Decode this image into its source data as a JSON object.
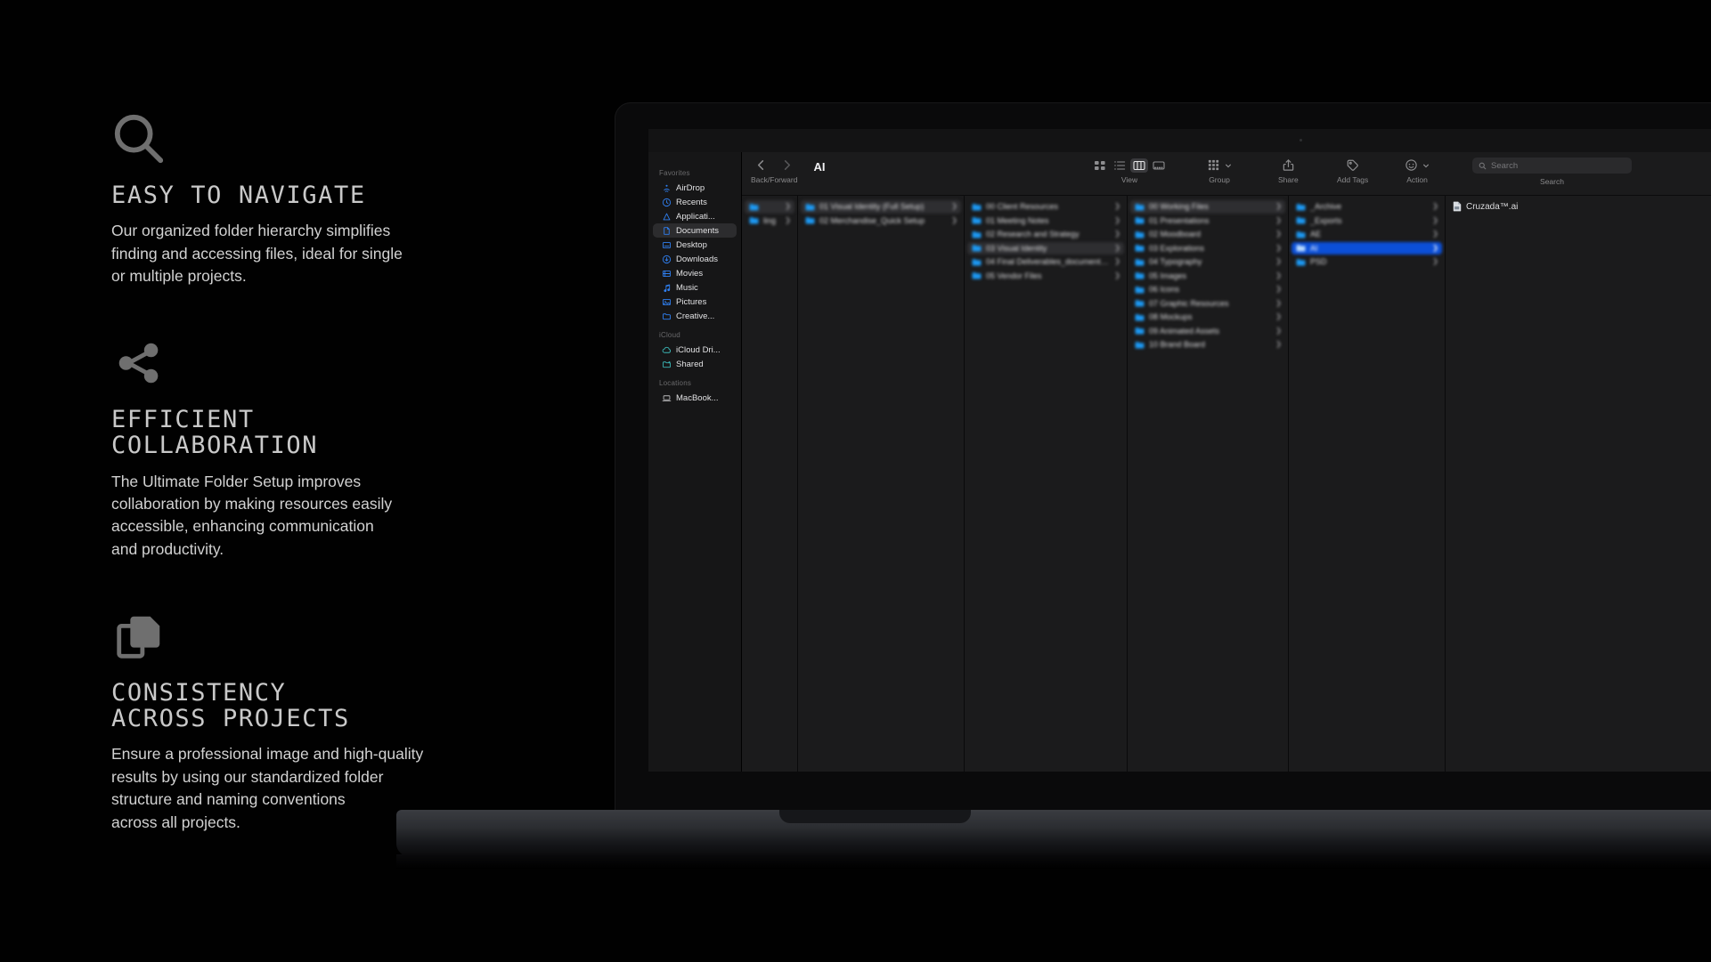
{
  "features": [
    {
      "icon": "magnifier-icon",
      "title": "EASY TO NAVIGATE",
      "body": "Our organized folder hierarchy simplifies\nfinding and accessing files, ideal for single\nor multiple projects."
    },
    {
      "icon": "share-nodes-icon",
      "title": "EFFICIENT\nCOLLABORATION",
      "body": "The Ultimate Folder Setup improves\ncollaboration by making resources easily\naccessible, enhancing communication\nand productivity."
    },
    {
      "icon": "copy-documents-icon",
      "title": "CONSISTENCY\nACROSS PROJECTS",
      "body": "Ensure a professional image and high-quality\nresults by using our standardized folder\nstructure and naming conventions\nacross all projects."
    }
  ],
  "finder": {
    "window_title": "AI",
    "toolbar": {
      "nav_caption": "Back/Forward",
      "back_icon": "chevron-left-icon",
      "forward_icon": "chevron-right-icon",
      "view_caption": "View",
      "view_icon_grid": "icon-view-icon",
      "view_icon_list": "list-view-icon",
      "view_icon_column": "column-view-icon",
      "view_icon_gallery": "gallery-view-icon",
      "group_caption": "Group",
      "group_icon": "group-icon",
      "share_caption": "Share",
      "share_icon": "share-icon",
      "tags_caption": "Add Tags",
      "tags_icon": "tag-icon",
      "action_caption": "Action",
      "action_icon": "action-ellipsis-icon",
      "search_caption": "Search",
      "search_placeholder": "Search",
      "search_icon": "search-icon"
    },
    "sidebar": {
      "sections": [
        {
          "label": "Favorites",
          "items": [
            {
              "label": "AirDrop",
              "icon": "airdrop-icon",
              "selected": false
            },
            {
              "label": "Recents",
              "icon": "clock-icon",
              "selected": false
            },
            {
              "label": "Applicati...",
              "icon": "applications-icon",
              "selected": false
            },
            {
              "label": "Documents",
              "icon": "document-icon",
              "selected": true
            },
            {
              "label": "Desktop",
              "icon": "desktop-icon",
              "selected": false
            },
            {
              "label": "Downloads",
              "icon": "downloads-icon",
              "selected": false
            },
            {
              "label": "Movies",
              "icon": "movies-icon",
              "selected": false
            },
            {
              "label": "Music",
              "icon": "music-note-icon",
              "selected": false
            },
            {
              "label": "Pictures",
              "icon": "pictures-icon",
              "selected": false
            },
            {
              "label": "Creative...",
              "icon": "folder-icon",
              "selected": false
            }
          ]
        },
        {
          "label": "iCloud",
          "items": [
            {
              "label": "iCloud Dri...",
              "icon": "cloud-icon",
              "selected": false
            },
            {
              "label": "Shared",
              "icon": "shared-folder-icon",
              "selected": false
            }
          ]
        },
        {
          "label": "Locations",
          "items": [
            {
              "label": "MacBook...",
              "icon": "laptop-icon",
              "selected": false
            }
          ]
        }
      ]
    },
    "columns": [
      {
        "name": "column-clipped",
        "blurred": true,
        "items": [
          {
            "label": "",
            "selected": false,
            "highlighted": true,
            "has_chevron": true
          },
          {
            "label": "ling",
            "selected": false,
            "highlighted": false,
            "has_chevron": true
          }
        ]
      },
      {
        "name": "column-projects",
        "blurred": true,
        "items": [
          {
            "label": "01 Visual Identity (Full Setup)",
            "selected": false,
            "highlighted": true,
            "has_chevron": true
          },
          {
            "label": "02 Merchandise_Quick Setup",
            "selected": false,
            "highlighted": false,
            "has_chevron": true
          }
        ]
      },
      {
        "name": "column-project-root",
        "blurred": true,
        "items": [
          {
            "label": "00 Client Resources",
            "selected": false,
            "highlighted": false,
            "has_chevron": true
          },
          {
            "label": "01 Meeting Notes",
            "selected": false,
            "highlighted": false,
            "has_chevron": true
          },
          {
            "label": "02 Research and Strategy",
            "selected": false,
            "highlighted": false,
            "has_chevron": true
          },
          {
            "label": "03 Visual Identity",
            "selected": false,
            "highlighted": true,
            "has_chevron": true
          },
          {
            "label": "04 Final Deliverables_documentation",
            "selected": false,
            "highlighted": false,
            "has_chevron": true
          },
          {
            "label": "05 Vendor Files",
            "selected": false,
            "highlighted": false,
            "has_chevron": true
          }
        ]
      },
      {
        "name": "column-visual-identity",
        "blurred": true,
        "items": [
          {
            "label": "00 Working Files",
            "selected": false,
            "highlighted": true,
            "has_chevron": true
          },
          {
            "label": "01 Presentations",
            "selected": false,
            "highlighted": false,
            "has_chevron": true
          },
          {
            "label": "02 Moodboard",
            "selected": false,
            "highlighted": false,
            "has_chevron": true
          },
          {
            "label": "03 Explorations",
            "selected": false,
            "highlighted": false,
            "has_chevron": true
          },
          {
            "label": "04 Typography",
            "selected": false,
            "highlighted": false,
            "has_chevron": true
          },
          {
            "label": "05 Images",
            "selected": false,
            "highlighted": false,
            "has_chevron": true
          },
          {
            "label": "06 Icons",
            "selected": false,
            "highlighted": false,
            "has_chevron": true
          },
          {
            "label": "07 Graphic Resources",
            "selected": false,
            "highlighted": false,
            "has_chevron": true
          },
          {
            "label": "08 Mockups",
            "selected": false,
            "highlighted": false,
            "has_chevron": true
          },
          {
            "label": "09 Animated Assets",
            "selected": false,
            "highlighted": false,
            "has_chevron": true
          },
          {
            "label": "10 Brand Board",
            "selected": false,
            "highlighted": false,
            "has_chevron": true
          }
        ]
      },
      {
        "name": "column-working-files",
        "blurred": true,
        "items": [
          {
            "label": "_Archive",
            "selected": false,
            "highlighted": false,
            "has_chevron": true
          },
          {
            "label": "_Exports",
            "selected": false,
            "highlighted": false,
            "has_chevron": true
          },
          {
            "label": "AE",
            "selected": false,
            "highlighted": false,
            "has_chevron": true
          },
          {
            "label": "AI",
            "selected": true,
            "highlighted": false,
            "has_chevron": true
          },
          {
            "label": "PSD",
            "selected": false,
            "highlighted": false,
            "has_chevron": true
          }
        ]
      }
    ],
    "preview_column": {
      "name": "column-ai-contents",
      "files": [
        {
          "label": "Cruzada™.ai",
          "icon": "illustrator-file-icon"
        }
      ]
    }
  },
  "colors": {
    "selection_blue": "#0b4fd8",
    "folder_blue": "#1d9bf6",
    "sidebar_icon_blue": "#2f7ff0",
    "sidebar_icon_teal": "#3bb6b6",
    "heading_grey": "#c9c9c9",
    "body_grey": "#d2d2d2",
    "icon_grey": "#6f6f6f",
    "background": "#010101"
  }
}
